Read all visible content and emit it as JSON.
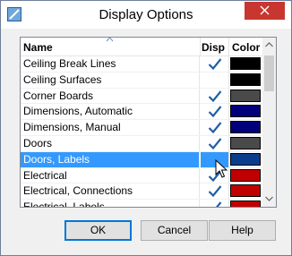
{
  "window": {
    "title": "Display Options",
    "close_glyph": "close-icon"
  },
  "columns": {
    "name": "Name",
    "disp": "Disp",
    "color": "Color"
  },
  "rows": [
    {
      "name": "Ceiling Break Lines",
      "disp": true,
      "color": "#000000",
      "selected": false
    },
    {
      "name": "Ceiling Surfaces",
      "disp": false,
      "color": "#000000",
      "selected": false
    },
    {
      "name": "Corner Boards",
      "disp": true,
      "color": "#4a4a4a",
      "selected": false
    },
    {
      "name": "Dimensions,  Automatic",
      "disp": true,
      "color": "#00007a",
      "selected": false
    },
    {
      "name": "Dimensions,  Manual",
      "disp": true,
      "color": "#00007a",
      "selected": false
    },
    {
      "name": "Doors",
      "disp": true,
      "color": "#4a4a4a",
      "selected": false
    },
    {
      "name": "Doors, Labels",
      "disp": false,
      "color": "#0a3d8c",
      "selected": true
    },
    {
      "name": "Electrical",
      "disp": true,
      "color": "#c00000",
      "selected": false
    },
    {
      "name": "Electrical, Connections",
      "disp": true,
      "color": "#c00000",
      "selected": false
    },
    {
      "name": "Electrical, Labels",
      "disp": true,
      "color": "#c00000",
      "selected": false
    }
  ],
  "buttons": {
    "ok": "OK",
    "cancel": "Cancel",
    "help": "Help"
  },
  "colors": {
    "check": "#1f5fa8",
    "selection": "#3399ff",
    "close_bg": "#c7372f"
  }
}
